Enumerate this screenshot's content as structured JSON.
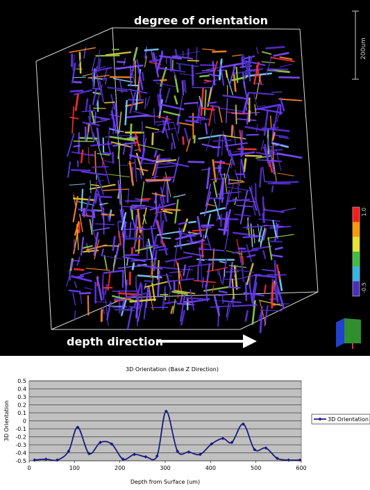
{
  "visualization": {
    "title": "degree of orientation",
    "arrow_label": "depth direction",
    "scale_label": "200um",
    "colorbar": {
      "max_label": "1.0",
      "min_label": "-0.5",
      "colors": [
        "#ff1a1a",
        "#ff9900",
        "#e6e62e",
        "#3fbf3f",
        "#33b7e6",
        "#4b2fb8"
      ]
    },
    "fiber_colors": [
      "#6a3cff",
      "#5b2fd6",
      "#7d4dff",
      "#ff3030",
      "#e6d23a",
      "#7fd3ff",
      "#8fd14f",
      "#ff8a2a",
      "#3f2fb0"
    ]
  },
  "chart_data": {
    "type": "line",
    "title": "3D Orientation (Base Z Direction)",
    "xlabel": "Depth from Surface (um)",
    "ylabel": "3D Orientation",
    "xlim": [
      0,
      600
    ],
    "ylim": [
      -0.5,
      0.5
    ],
    "xticks": [
      "0",
      "100",
      "200",
      "300",
      "400",
      "500",
      "600"
    ],
    "yticks": [
      "0.5",
      "0.4",
      "0.3",
      "0.2",
      "0.1",
      "0",
      "-0.1",
      "-0.2",
      "-0.3",
      "-0.4",
      "-0.5"
    ],
    "legend_position": "right",
    "grid": true,
    "series": [
      {
        "name": "3D Orientation",
        "color": "#1a1a80",
        "x": [
          12,
          37,
          62,
          87,
          107,
          132,
          157,
          182,
          207,
          232,
          257,
          282,
          302,
          327,
          352,
          377,
          402,
          427,
          447,
          472,
          497,
          522,
          547,
          572,
          597
        ],
        "y": [
          -0.49,
          -0.48,
          -0.49,
          -0.38,
          -0.08,
          -0.41,
          -0.27,
          -0.29,
          -0.48,
          -0.42,
          -0.45,
          -0.44,
          0.12,
          -0.38,
          -0.39,
          -0.42,
          -0.29,
          -0.22,
          -0.27,
          -0.04,
          -0.36,
          -0.34,
          -0.47,
          -0.49,
          -0.49
        ]
      }
    ]
  }
}
